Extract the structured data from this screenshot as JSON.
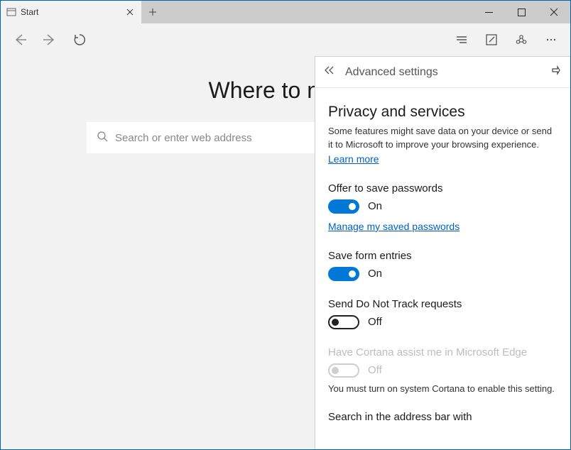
{
  "tab": {
    "title": "Start"
  },
  "page": {
    "headline": "Where to next?",
    "search_placeholder": "Search or enter web address"
  },
  "panel": {
    "title": "Advanced settings",
    "section_title": "Privacy and services",
    "section_desc": "Some features might save data on your device or send it to Microsoft to improve your browsing experience.",
    "learn_more": "Learn more",
    "settings": {
      "save_passwords": {
        "label": "Offer to save passwords",
        "state": "On",
        "manage_link": "Manage my saved passwords"
      },
      "form_entries": {
        "label": "Save form entries",
        "state": "On"
      },
      "do_not_track": {
        "label": "Send Do Not Track requests",
        "state": "Off"
      },
      "cortana": {
        "label": "Have Cortana assist me in Microsoft Edge",
        "state": "Off",
        "note": "You must turn on system Cortana to enable this setting."
      },
      "address_bar": {
        "label": "Search in the address bar with"
      }
    }
  }
}
